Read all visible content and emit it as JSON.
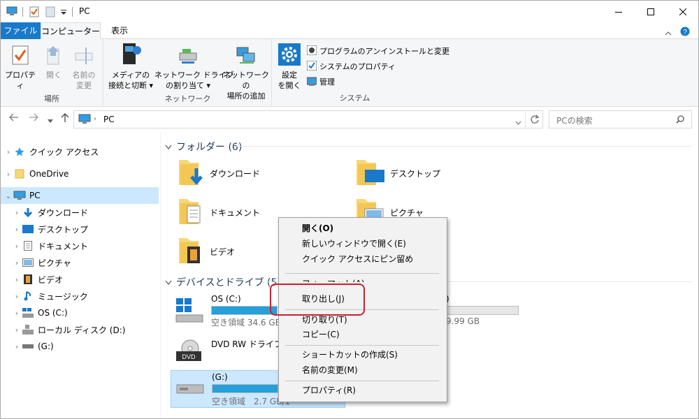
{
  "window": {
    "title": "PC",
    "title_icons": [
      "computer-icon",
      "properties-check-icon",
      "new-folder-icon",
      "qat-dropdown-icon"
    ]
  },
  "ribbon_tabs": {
    "file": "ファイル",
    "computer": "コンピューター",
    "view": "表示"
  },
  "ribbon": {
    "location": {
      "label": "場所",
      "properties": "プロパティ",
      "open": "開く",
      "rename_line1": "名前の",
      "rename_line2": "変更"
    },
    "network": {
      "label": "ネットワーク",
      "media_line1": "メディアの",
      "media_line2": "接続と切断",
      "map_line1": "ネットワーク ドライブ",
      "map_line2": "の割り当て",
      "add_line1": "ネットワークの",
      "add_line2": "場所の追加"
    },
    "system": {
      "label": "システム",
      "settings_line1": "設定",
      "settings_line2": "を開く",
      "uninstall": "プログラムのアンインストールと変更",
      "sys_props": "システムのプロパティ",
      "manage": "管理"
    }
  },
  "address": {
    "path": "PC",
    "search_placeholder": "PCの検索"
  },
  "nav_tree": [
    {
      "label": "クイック アクセス",
      "icon": "star-icon"
    },
    {
      "label": "OneDrive",
      "icon": "onedrive-folder-icon"
    },
    {
      "label": "PC",
      "icon": "computer-icon"
    },
    {
      "label": "ダウンロード",
      "icon": "download-icon"
    },
    {
      "label": "デスクトップ",
      "icon": "desktop-icon"
    },
    {
      "label": "ドキュメント",
      "icon": "document-icon"
    },
    {
      "label": "ピクチャ",
      "icon": "picture-icon"
    },
    {
      "label": "ビデオ",
      "icon": "video-icon"
    },
    {
      "label": "ミュージック",
      "icon": "music-icon"
    },
    {
      "label": "OS (C:)",
      "icon": "windows-drive-icon"
    },
    {
      "label": "ローカル ディスク (D:)",
      "icon": "local-disk-icon"
    },
    {
      "label": "(G:)",
      "icon": "usb-drive-icon"
    }
  ],
  "folders": {
    "header": "フォルダー (6)",
    "items": [
      "ダウンロード",
      "デスクトップ",
      "ドキュメント",
      "ピクチャ",
      "ビデオ"
    ]
  },
  "drives": {
    "header": "デバイスとドライブ (5)",
    "os_c": {
      "name": "OS (C:)",
      "free": "空き領域 34.6 GB/2"
    },
    "dvd": {
      "name": "DVD RW ドライブ (E:"
    },
    "g": {
      "name": "(G:)",
      "free": "空き領域　2.7 GB/1"
    },
    "d_partial": {
      "name": ":)",
      "free": "/9.99 GB"
    }
  },
  "context_menu": {
    "open": "開く(O)",
    "open_new_window": "新しいウィンドウで開く(E)",
    "pin_quick": "クイック アクセスにピン留め",
    "format": "フォーマット(A)...",
    "eject": "取り出し(J)",
    "cut": "切り取り(T)",
    "copy": "コピー(C)",
    "create_shortcut": "ショートカットの作成(S)",
    "rename": "名前の変更(M)",
    "properties": "プロパティ(R)"
  },
  "colors": {
    "accent": "#1979ca",
    "selection": "#cce8ff",
    "highlight_ring": "#cc1f2f",
    "drive_bar": "#26a0da"
  }
}
